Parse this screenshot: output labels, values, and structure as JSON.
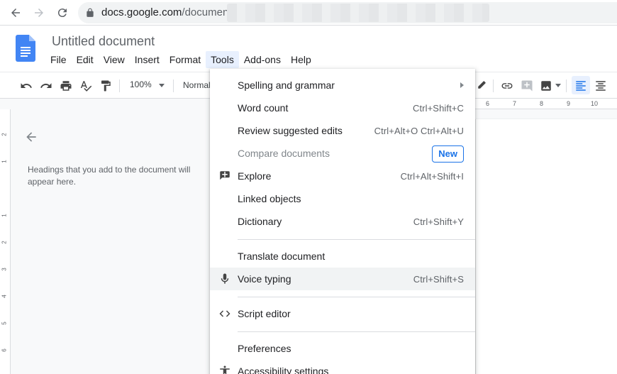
{
  "browser": {
    "url_host": "docs.google.com",
    "url_path": "/document/"
  },
  "doc": {
    "title": "Untitled document"
  },
  "menubar": [
    {
      "label": "File"
    },
    {
      "label": "Edit"
    },
    {
      "label": "View"
    },
    {
      "label": "Insert"
    },
    {
      "label": "Format"
    },
    {
      "label": "Tools"
    },
    {
      "label": "Add-ons"
    },
    {
      "label": "Help"
    }
  ],
  "toolbar": {
    "zoom": "100%",
    "style": "Normal"
  },
  "outline": {
    "message": "Headings that you add to the document will appear here."
  },
  "ruler": {
    "h_ticks": [
      "6",
      "7",
      "8",
      "9",
      "10"
    ],
    "v_ticks": [
      "2",
      "1",
      "1",
      "2",
      "3",
      "4",
      "5",
      "6"
    ]
  },
  "tools_menu": {
    "items": [
      {
        "label": "Spelling and grammar",
        "shortcut": ""
      },
      {
        "label": "Word count",
        "shortcut": "Ctrl+Shift+C"
      },
      {
        "label": "Review suggested edits",
        "shortcut": "Ctrl+Alt+O Ctrl+Alt+U"
      },
      {
        "label": "Compare documents",
        "badge": "New"
      },
      {
        "label": "Explore",
        "shortcut": "Ctrl+Alt+Shift+I"
      },
      {
        "label": "Linked objects",
        "shortcut": ""
      },
      {
        "label": "Dictionary",
        "shortcut": "Ctrl+Shift+Y"
      },
      {
        "label": "Translate document",
        "shortcut": ""
      },
      {
        "label": "Voice typing",
        "shortcut": "Ctrl+Shift+S"
      },
      {
        "label": "Script editor",
        "shortcut": ""
      },
      {
        "label": "Preferences",
        "shortcut": ""
      },
      {
        "label": "Accessibility settings",
        "shortcut": ""
      }
    ]
  },
  "colors": {
    "accent": "#1a73e8",
    "docs_blue": "#4285f4",
    "menu_active_bg": "#e8f0fe"
  }
}
